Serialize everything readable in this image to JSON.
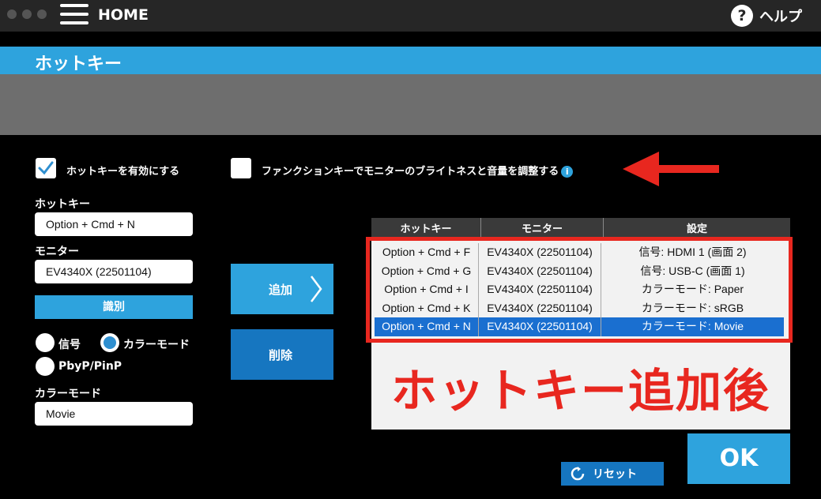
{
  "header": {
    "home_label": "HOME",
    "help_label": "ヘルプ",
    "help_glyph": "?"
  },
  "section": {
    "title": "ホットキー"
  },
  "options": {
    "enable_hotkey": {
      "label": "ホットキーを有効にする",
      "checked": true
    },
    "function_keys": {
      "label": "ファンクションキーでモニターのブライトネスと音量を調整する",
      "checked": false,
      "info_glyph": "i"
    }
  },
  "form": {
    "hotkey_label": "ホットキー",
    "hotkey_value": "Option + Cmd + N",
    "monitor_label": "モニター",
    "monitor_value": "EV4340X (22501104)",
    "identify_label": "識別",
    "radio_signal": "信号",
    "radio_colormode": "カラーモード",
    "radio_pbyp": "PbyP/PinP",
    "selected_radio": "カラーモード",
    "colormode_label": "カラーモード",
    "colormode_value": "Movie"
  },
  "actions": {
    "add_label": "追加",
    "delete_label": "削除",
    "reset_label": "リセット",
    "ok_label": "OK"
  },
  "table": {
    "headers": [
      "ホットキー",
      "モニター",
      "設定"
    ],
    "rows": [
      [
        "Option + Cmd + F",
        "EV4340X (22501104)",
        "信号: HDMI 1 (画面 2)"
      ],
      [
        "Option + Cmd + G",
        "EV4340X (22501104)",
        "信号: USB-C (画面 1)"
      ],
      [
        "Option + Cmd + I",
        "EV4340X (22501104)",
        "カラーモード: Paper"
      ],
      [
        "Option + Cmd + K",
        "EV4340X (22501104)",
        "カラーモード: sRGB"
      ],
      [
        "Option + Cmd + N",
        "EV4340X (22501104)",
        "カラーモード: Movie"
      ]
    ],
    "selected_row": 4
  },
  "annotation": {
    "caption": "ホットキー追加後",
    "color": "#e8271f"
  },
  "colors": {
    "accent": "#2ea3dd",
    "dark_button": "#1676c0",
    "selection": "#1a6fd0"
  }
}
